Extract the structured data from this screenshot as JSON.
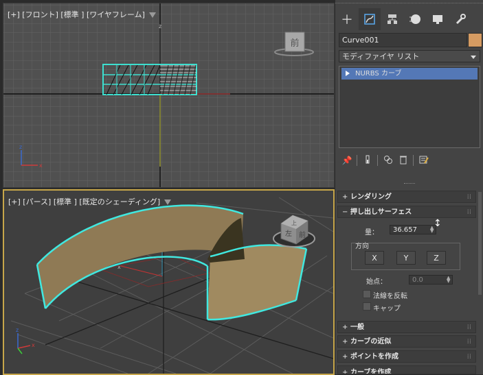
{
  "viewport_top": {
    "label": "[+] [フロント] [標準 ] [ワイヤフレーム]",
    "viewcube_label": "前",
    "axis_z": "z",
    "axis_x": "x"
  },
  "viewport_persp": {
    "label": "[+] [パース] [標準 ] [既定のシェーディング]",
    "viewcube_face1": "上",
    "viewcube_face2": "左",
    "viewcube_face3": "前",
    "axis_z": "z",
    "axis_x": "x"
  },
  "panel": {
    "tabs": [
      "create-tab",
      "modify-tab",
      "hierarchy-tab",
      "motion-tab",
      "display-tab",
      "utilities-tab"
    ],
    "object_name": "Curve001",
    "object_color": "#d59b62",
    "modifier_list": "モディファイヤ リスト",
    "stack_item": "NURBS カーブ",
    "rollouts": {
      "rendering": "レンダリング",
      "extrude_surface": "押し出しサーフェス",
      "general": "一般",
      "curve_approx": "カーブの近似",
      "create_points": "ポイントを作成",
      "create_curves": "カーブを作成"
    },
    "amount_label": "量：",
    "amount_value": "36.657",
    "direction_label": "方向",
    "axis_x": "X",
    "axis_y": "Y",
    "axis_z": "Z",
    "start_label": "始点：",
    "start_value": "0.0",
    "flip_normals": "法線を反転",
    "cap": "キャップ"
  }
}
